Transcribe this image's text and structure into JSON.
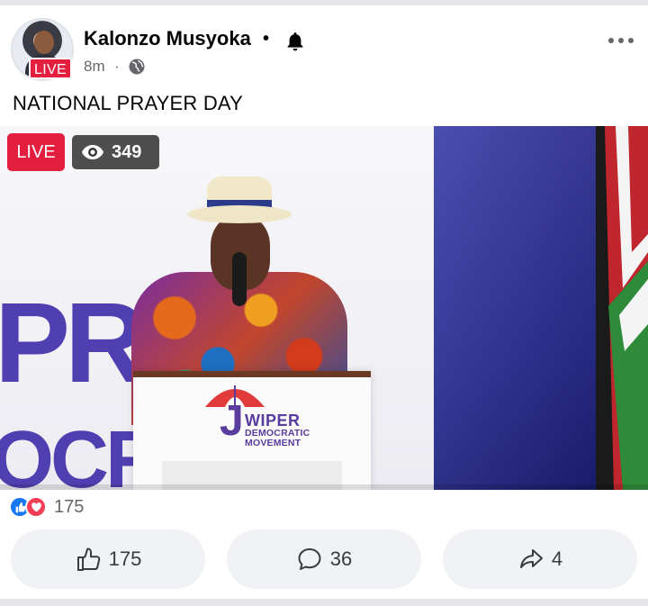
{
  "post": {
    "author": "Kalonzo Musyoka",
    "author_live_label": "LIVE",
    "separator": "•",
    "time": "8m",
    "meta_separator": "·",
    "audience_icon": "globe-icon",
    "follow_icon": "bell-icon",
    "more_icon": "more-horizontal-icon",
    "text": "NATIONAL PRAYER DAY"
  },
  "video": {
    "live_label": "LIVE",
    "viewer_icon": "eye-icon",
    "viewer_count": "349",
    "backdrop_letters_1": "PR",
    "backdrop_letters_2": "OCR",
    "podium_logo": {
      "initial": "J",
      "line1": "WIPER",
      "line2": "DEMOCRATIC",
      "line3": "MOVEMENT"
    }
  },
  "reactions": {
    "icons": [
      "like-icon",
      "love-icon"
    ],
    "count": "175"
  },
  "actions": {
    "like_count": "175",
    "comment_count": "36",
    "share_count": "4"
  },
  "colors": {
    "live_red": "#e41e3f",
    "like_blue": "#1877f2",
    "love_red": "#f33e58",
    "button_bg": "#f0f2f5",
    "party_purple": "#5a3c9e"
  }
}
